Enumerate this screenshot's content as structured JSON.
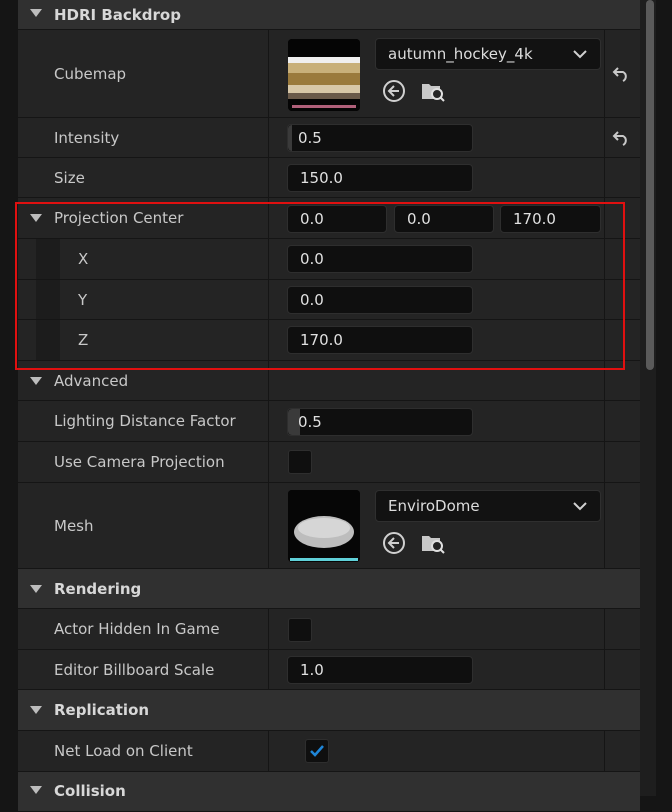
{
  "sections": {
    "hdri_backdrop": "HDRI Backdrop",
    "rendering": "Rendering",
    "replication": "Replication",
    "collision": "Collision"
  },
  "cubemap": {
    "label": "Cubemap",
    "asset": "autumn_hockey_4k"
  },
  "intensity": {
    "label": "Intensity",
    "value": "0.5"
  },
  "size": {
    "label": "Size",
    "value": "150.0"
  },
  "projection_center": {
    "label": "Projection Center",
    "x_value": "0.0",
    "y_value": "0.0",
    "z_value": "170.0",
    "x_label": "X",
    "y_label": "Y",
    "z_label": "Z"
  },
  "advanced": {
    "label": "Advanced"
  },
  "lighting_distance_factor": {
    "label": "Lighting Distance Factor",
    "value": "0.5"
  },
  "use_camera_projection": {
    "label": "Use Camera Projection",
    "checked": false
  },
  "mesh": {
    "label": "Mesh",
    "asset": "EnviroDome"
  },
  "actor_hidden_in_game": {
    "label": "Actor Hidden In Game",
    "checked": false
  },
  "editor_billboard_scale": {
    "label": "Editor Billboard Scale",
    "value": "1.0"
  },
  "net_load_on_client": {
    "label": "Net Load on Client",
    "checked": true
  },
  "colors": {
    "panel": "#242424",
    "category": "#303030",
    "field": "#0f0f0f",
    "highlight": "#e01010",
    "check_accent": "#1f86d8"
  }
}
